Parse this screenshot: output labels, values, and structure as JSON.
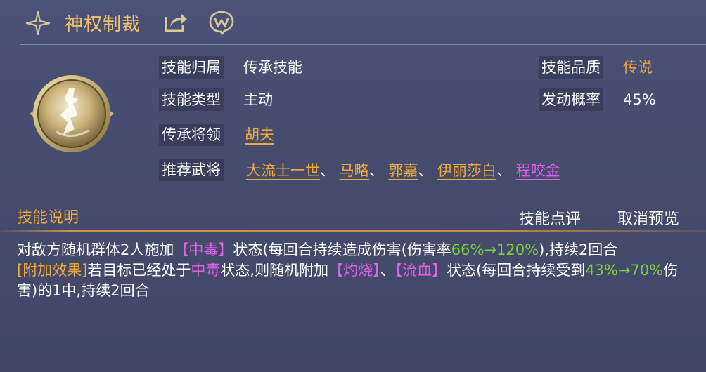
{
  "header": {
    "title": "神权制裁"
  },
  "fields": {
    "belong_label": "技能归属",
    "belong_value": "传承技能",
    "quality_label": "技能品质",
    "quality_value": "传说",
    "type_label": "技能类型",
    "type_value": "主动",
    "rate_label": "发动概率",
    "rate_value": "45%",
    "general_label": "传承将领",
    "general_value": "胡夫",
    "recommend_label": "推荐武将",
    "recommend": [
      "大流士一世",
      "马略",
      "郭嘉",
      "伊丽莎白",
      "程咬金"
    ],
    "separator": "、"
  },
  "section": {
    "title": "技能说明",
    "review_button": "技能点评",
    "cancel_preview_button": "取消预览"
  },
  "description": {
    "p1_a": "对敌方随机群体2人施加",
    "p1_tag": "【中毒】",
    "p1_b": "状态(每回合持续造成伤害(伤害率",
    "p1_pct": "66%→120%",
    "p1_c": "),持续2回合",
    "p2_tag": "[附加效果]",
    "p2_a": "若目标已经处于",
    "p2_state": "中毒",
    "p2_b": "状态,则随机附加",
    "p2_tag2": "【灼烧】",
    "p2_sep": "、",
    "p2_tag3": "【流血】",
    "p2_c": "状态(每回合持续受到",
    "p2_pct": "43%→70%",
    "p2_d": "伤害)的1中,持续2回合"
  },
  "colors": {
    "gold": "#f0a93a",
    "title_gold": "#f0c36a",
    "magenta": "#e060e8",
    "green": "#7fcf3a"
  },
  "icons": [
    "sparkle-star-icon",
    "share-icon",
    "w-chat-icon",
    "skill-emblem-icon"
  ]
}
